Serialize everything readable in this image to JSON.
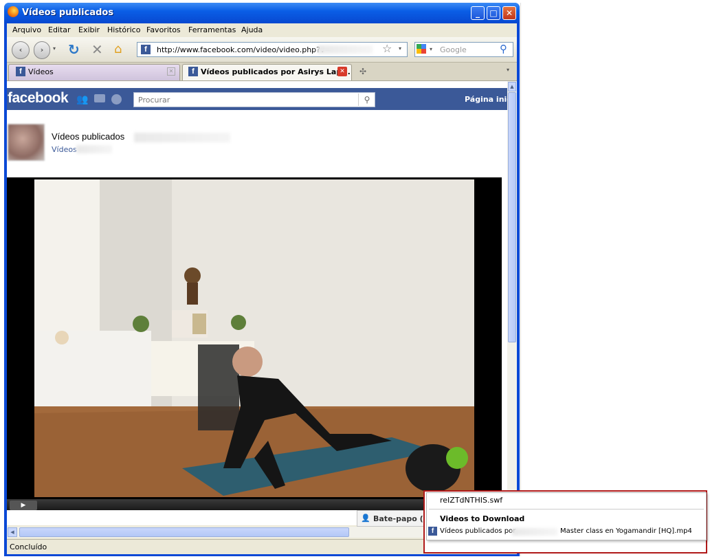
{
  "window": {
    "title": "Vídeos publicados",
    "minimize": "_",
    "maximize": "□",
    "close": "✕"
  },
  "menu": {
    "items": [
      "Arquivo",
      "Editar",
      "Exibir",
      "Histórico",
      "Favoritos",
      "Ferramentas",
      "Ajuda"
    ]
  },
  "nav": {
    "url": "http://www.facebook.com/video/video.php?v=",
    "search_placeholder": "Google",
    "favicon": "f"
  },
  "tabs": [
    {
      "label": "Vídeos"
    },
    {
      "label": "Vídeos publicados por Asirys Lap..."
    }
  ],
  "facebook": {
    "logo": "facebook",
    "search_placeholder": "Procurar",
    "home": "Página inic",
    "page_title": "Vídeos publicados",
    "page_sub": "Vídeos",
    "chat": "Bate-papo (",
    "favicon": "f"
  },
  "status": {
    "text": "Concluído"
  },
  "popup": {
    "swf": "reIZTdNTHIS.swf",
    "header": "Videos to Download",
    "item_prefix": "Vídeos publicados por",
    "item_title": "Master class en Yogamandir [HQ].mp4"
  },
  "colors": {
    "fb_blue": "#3b5998",
    "xp_title": "#0a5ee6",
    "highlight_red": "#b01818"
  }
}
